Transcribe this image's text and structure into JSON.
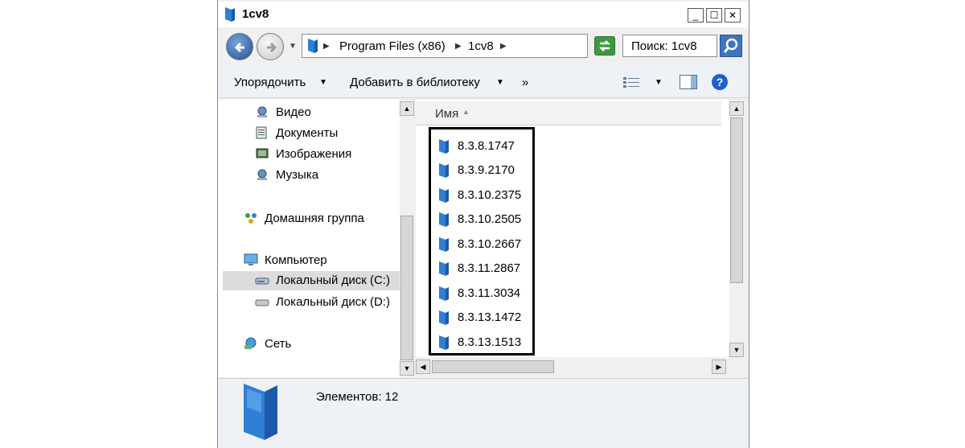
{
  "window": {
    "title": "1cv8"
  },
  "window_buttons": {
    "minimize": "_",
    "maximize": "☐",
    "close": "✕"
  },
  "address": {
    "crumbs": [
      "Program Files (x86)",
      "1cv8"
    ]
  },
  "search": {
    "text": "Поиск: 1cv8"
  },
  "toolbar": {
    "organize": "Упорядочить",
    "add_library": "Добавить в библиотеку",
    "more": "»"
  },
  "navpane": {
    "items": [
      {
        "label": "Видео",
        "icon": "video-library-icon"
      },
      {
        "label": "Документы",
        "icon": "documents-library-icon"
      },
      {
        "label": "Изображения",
        "icon": "pictures-library-icon"
      },
      {
        "label": "Музыка",
        "icon": "music-library-icon"
      },
      {
        "label": "Домашняя группа",
        "icon": "homegroup-icon"
      },
      {
        "label": "Компьютер",
        "icon": "computer-icon"
      },
      {
        "label": "Локальный диск (C:)",
        "icon": "drive-c-icon",
        "selected": true
      },
      {
        "label": "Локальный диск (D:)",
        "icon": "drive-d-icon"
      },
      {
        "label": "Сеть",
        "icon": "network-icon"
      }
    ]
  },
  "files": {
    "column_header": "Имя",
    "items": [
      "8.3.8.1747",
      "8.3.9.2170",
      "8.3.10.2375",
      "8.3.10.2505",
      "8.3.10.2667",
      "8.3.11.2867",
      "8.3.11.3034",
      "8.3.13.1472",
      "8.3.13.1513"
    ]
  },
  "status": {
    "text": "Элементов: 12"
  },
  "colors": {
    "folder_blue": "#2f7fd6",
    "selection": "#dcdcdc",
    "highlight_border": "#000000"
  }
}
